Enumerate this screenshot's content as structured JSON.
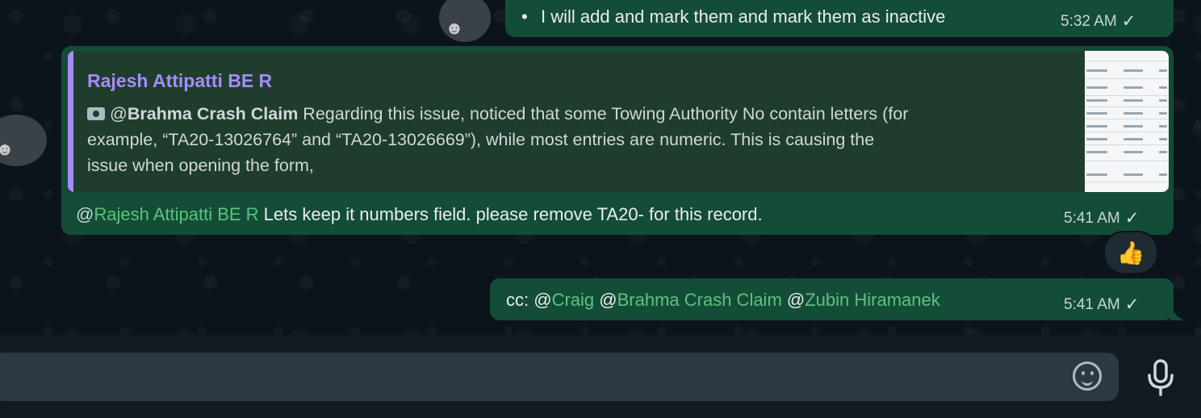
{
  "messages": [
    {
      "bullet": "•",
      "text": "I will add and mark them and mark them as inactive",
      "time": "5:32 AM"
    },
    {
      "quoted": {
        "author": "Rajesh Attipatti BE R",
        "at": "@",
        "mention": "Brahma Crash Claim",
        "line1": " Regarding this issue,  noticed that some Towing Authority No contain letters (for",
        "line2": "example, “TA20-13026764” and “TA20-13026669”), while most entries are numeric. This is causing the",
        "line3": "issue when opening the form,"
      },
      "at": "@",
      "mention": "Rajesh Attipatti BE R",
      "text": " Lets keep it numbers field.  please remove TA20- for this record.",
      "time": "5:41 AM",
      "reaction": "👍"
    },
    {
      "prefix": "cc: ",
      "at1": "@",
      "mention1": "Craig",
      "at2": " @",
      "mention2": "Brahma Crash Claim",
      "at3": " @",
      "mention3": "Zubin Hiramanek",
      "time": "5:41 AM"
    }
  ],
  "check_glyph": "✓",
  "avatar_face": "☻",
  "composer": {
    "placeholder": ""
  },
  "icons": {
    "status": "single-check-icon",
    "emoji": "emoji-icon",
    "voice": "microphone-icon",
    "attachment": "camera-icon"
  },
  "colors": {
    "bubble": "#144d37",
    "mention": "#5cc27e",
    "quote_author": "#a78bfa",
    "background": "#0b141a"
  }
}
